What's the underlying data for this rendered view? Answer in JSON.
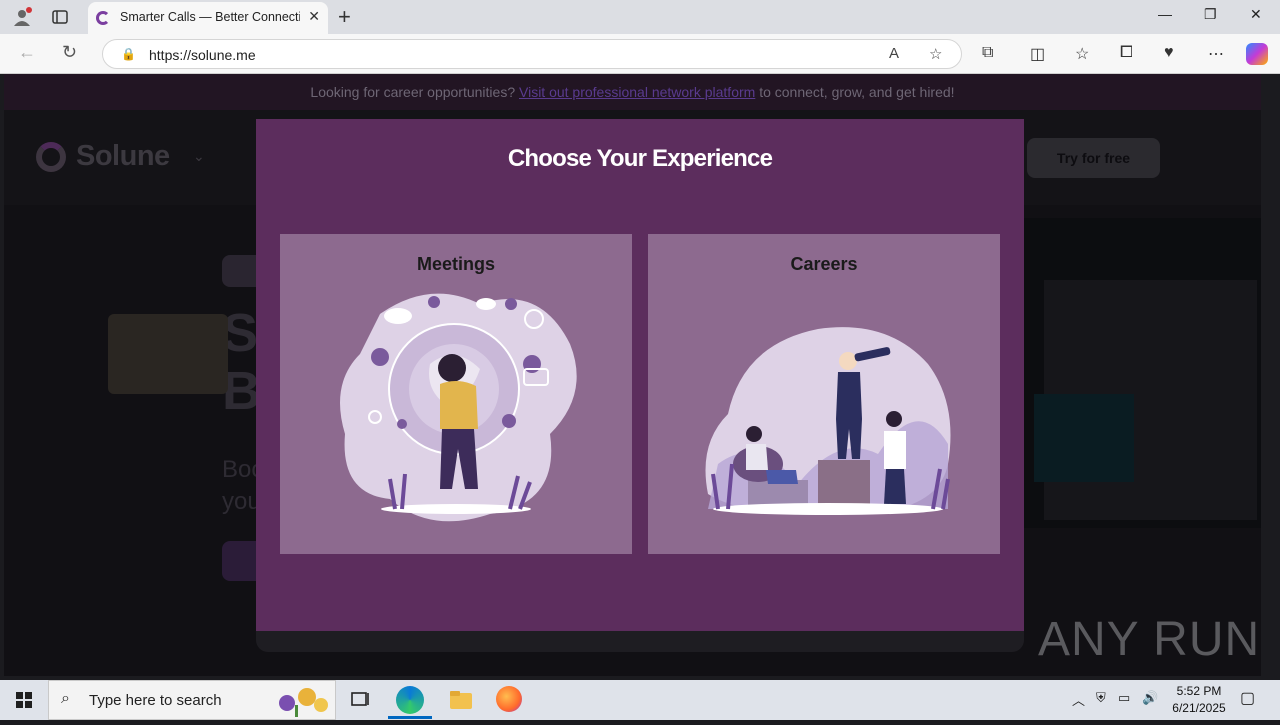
{
  "browser": {
    "tab_title": "Smarter Calls — Better Connectio",
    "url": "https://solune.me",
    "new_tab_label": "+",
    "window_controls": [
      "minimize-icon",
      "restore-icon",
      "close-icon"
    ]
  },
  "banner": {
    "text_before": "Looking for career opportunities?",
    "link": "Visit out professional network platform",
    "text_after": "to connect, grow, and get hired!"
  },
  "header": {
    "logo": "Solune",
    "cta": "Try for free"
  },
  "hero": {
    "line1": "S",
    "line2": "B",
    "sub1": "Boo",
    "sub2": "you"
  },
  "modal": {
    "title": "Choose Your Experience",
    "cards": [
      {
        "label": "Meetings",
        "illustration": "globe-people-illustration"
      },
      {
        "label": "Careers",
        "illustration": "career-telescope-illustration"
      }
    ],
    "colors": {
      "background": "#5c2d5d",
      "card": "#8d6a8f"
    }
  },
  "watermark": "ANY RUN",
  "taskbar": {
    "search_placeholder": "Type here to search",
    "time": "5:52 PM",
    "date": "6/21/2025"
  }
}
